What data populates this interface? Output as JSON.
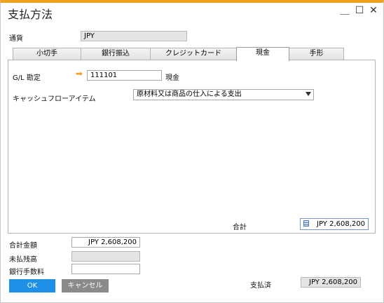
{
  "window": {
    "title": "支払方法",
    "minimize_glyph": "＿",
    "maximize_glyph": "☐",
    "close_glyph": "✕"
  },
  "currency": {
    "label": "通貨",
    "value": "JPY"
  },
  "tabs": [
    {
      "label": "小切手",
      "active": false
    },
    {
      "label": "銀行振込",
      "active": false
    },
    {
      "label": "クレジットカード",
      "active": false
    },
    {
      "label": "現金",
      "active": true
    },
    {
      "label": "手形",
      "active": false
    }
  ],
  "cash": {
    "gl_label": "G/L 勘定",
    "gl_value": "111101",
    "gl_name": "現金",
    "cashflow_label": "キャッシュフローアイテム",
    "cashflow_value": "原材料又は商品の仕入による支出",
    "total_label": "合計",
    "total_value": "JPY 2,608,200"
  },
  "summary": {
    "total_amount_label": "合計金額",
    "total_amount_value": "JPY 2,608,200",
    "balance_due_label": "未払残高",
    "balance_due_value": "",
    "bank_fee_label": "銀行手数料",
    "bank_fee_value": "",
    "paid_label": "支払済",
    "paid_value": "JPY 2,608,200"
  },
  "buttons": {
    "ok": "OK",
    "cancel": "キャンセル"
  },
  "colors": {
    "accent": "#f0a020",
    "ok_button": "#1e90e8",
    "cancel_button": "#8a8a8a"
  }
}
